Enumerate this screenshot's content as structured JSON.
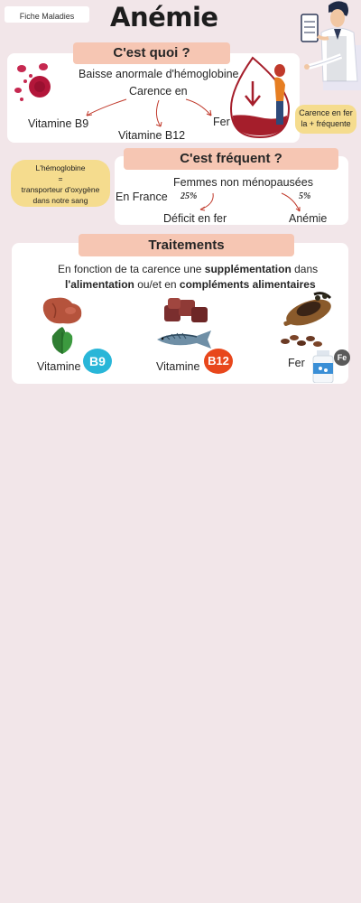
{
  "header": {
    "category_label": "Fiche Maladies",
    "title": "Anémie"
  },
  "what": {
    "heading": "C'est quoi ?",
    "definition": "Baisse anormale d'hémoglobine",
    "deficiency_label": "Carence en",
    "vit_b9": "Vitamine B9",
    "vit_b12": "Vitamine B12",
    "iron": "Fer",
    "note": [
      "Carence en fer",
      "la + fréquente"
    ]
  },
  "freq": {
    "heading": "C'est fréquent ?",
    "hemoglobin_bubble": [
      "L'hémoglobine",
      "=",
      "transporteur d'oxygène",
      "dans notre sang"
    ],
    "population": "Femmes non ménopausées",
    "region": "En France",
    "iron_deficit_pct": "25%",
    "anemia_pct": "5%",
    "iron_deficit_label": "Déficit en fer",
    "anemia_label": "Anémie"
  },
  "treat": {
    "heading": "Traitements",
    "line1": {
      "a": "En fonction de ta carence une ",
      "b": "supplémentation",
      "c": " dans"
    },
    "line2": {
      "a": "l'alimentation",
      "b": " ou/et en ",
      "c": "compléments alimentaires"
    },
    "b9_label": "Vitamine",
    "b9_badge": "B9",
    "b12_label": "Vitamine",
    "b12_badge": "B12",
    "iron_label": "Fer",
    "iron_badge": "Fe"
  },
  "colors": {
    "background": "#f2e6e9",
    "pill": "#f6c6b3",
    "bubble": "#f5dc8e",
    "b9_badge": "#29b6d8",
    "b12_badge": "#e8471c",
    "arrow": "#c0392b",
    "blood": "#a51e2b"
  }
}
